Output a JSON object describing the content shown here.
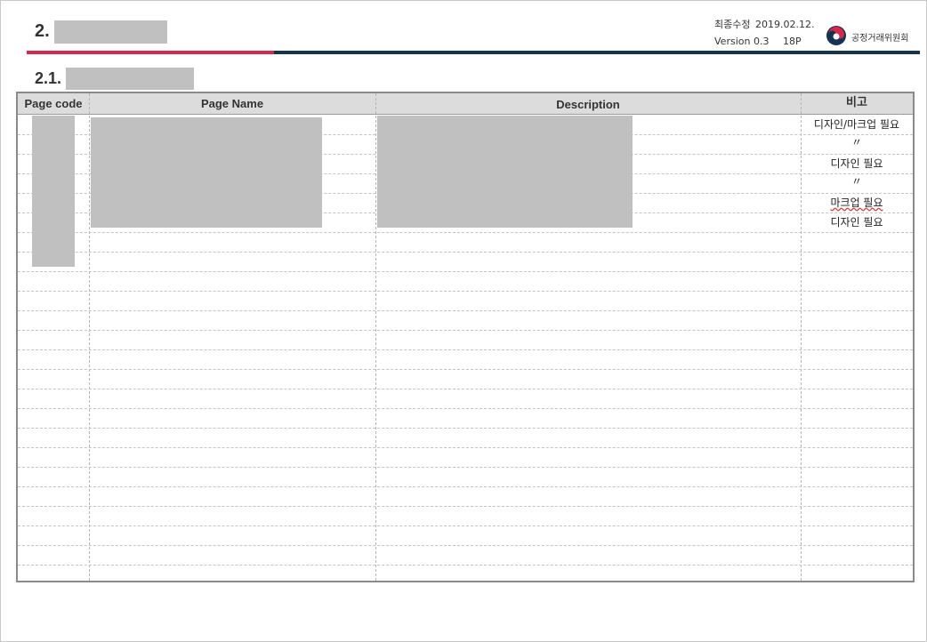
{
  "header": {
    "section_number": "2.",
    "last_modified_label": "최종수정",
    "last_modified_date": "2019.02.12.",
    "version": "Version 0.3",
    "page": "18P",
    "org_name": "공정거래위원회"
  },
  "subsection": {
    "number": "2.1."
  },
  "table": {
    "columns": [
      "Page code",
      "Page Name",
      "Description",
      "비고"
    ],
    "notes": [
      "디자인/마크업 필요",
      "〃",
      "디자인 필요",
      "〃",
      "마크업 필요",
      "디자인 필요"
    ]
  }
}
